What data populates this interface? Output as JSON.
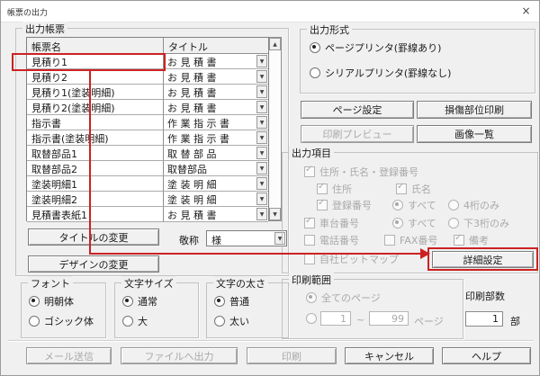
{
  "window": {
    "title": "帳票の出力",
    "close_glyph": "×"
  },
  "output_report": {
    "label": "出力帳票",
    "table": {
      "headers": [
        "帳票名",
        "タイトル"
      ],
      "rows": [
        {
          "name": "見積り1",
          "title": "お 見 積 書"
        },
        {
          "name": "見積り2",
          "title": "お 見 積 書"
        },
        {
          "name": "見積り1(塗装明細)",
          "title": "お 見 積 書"
        },
        {
          "name": "見積り2(塗装明細)",
          "title": "お 見 積 書"
        },
        {
          "name": "指示書",
          "title": "作 業 指 示 書"
        },
        {
          "name": "指示書(塗装明細)",
          "title": "作 業 指 示 書"
        },
        {
          "name": "取替部品1",
          "title": "取 替 部 品"
        },
        {
          "name": "取替部品2",
          "title": "取替部品"
        },
        {
          "name": "塗装明細1",
          "title": "塗 装 明 細"
        },
        {
          "name": "塗装明細2",
          "title": "塗 装 明 細"
        },
        {
          "name": "見積書表紙1",
          "title": "お 見 積 書"
        }
      ]
    },
    "change_title_button": "タイトルの変更",
    "change_design_button": "デザインの変更",
    "honorific": {
      "label": "敬称",
      "value": "様"
    }
  },
  "output_format": {
    "label": "出力形式",
    "options": [
      {
        "label": "ページプリンタ(罫線あり)",
        "selected": true
      },
      {
        "label": "シリアルプリンタ(罫線なし)",
        "selected": false
      }
    ]
  },
  "side_buttons": {
    "page_setup": "ページ設定",
    "damage_area_print": "損傷部位印刷",
    "print_preview": "印刷プレビュー",
    "image_list": "画像一覧"
  },
  "output_items": {
    "label": "出力項目",
    "address_name_reg": "住所・氏名・登録番号",
    "address": "住所",
    "name": "氏名",
    "registration_no": "登録番号",
    "all_a": "すべて",
    "four_digits": "4桁のみ",
    "chassis_no": "車台番号",
    "all_b": "すべて",
    "last3_digits": "下3桁のみ",
    "telephone": "電話番号",
    "fax": "FAX番号",
    "remarks": "備考",
    "company_bitmap": "自社ビットマップ",
    "detail_button": "詳細設定"
  },
  "font_group": {
    "label": "フォント",
    "options": [
      "明朝体",
      "ゴシック体"
    ]
  },
  "size_group": {
    "label": "文字サイズ",
    "options": [
      "通常",
      "大"
    ]
  },
  "weight_group": {
    "label": "文字の太さ",
    "options": [
      "普通",
      "太い"
    ]
  },
  "print_range": {
    "label": "印刷範囲",
    "all_pages": "全てのページ",
    "from_value": "1",
    "tilde": "~",
    "to_value": "99",
    "pages_label": "ページ"
  },
  "copies": {
    "label": "印刷部数",
    "value": "1",
    "unit": "部"
  },
  "bottom_buttons": {
    "mail": "メール送信",
    "file_output": "ファイルへ出力",
    "print": "印刷",
    "cancel": "キャンセル",
    "help": "ヘルプ"
  },
  "colors": {
    "annotation_red": "#cc2222"
  },
  "icons": {
    "dropdown": "▼",
    "up": "▲",
    "down": "▼"
  }
}
